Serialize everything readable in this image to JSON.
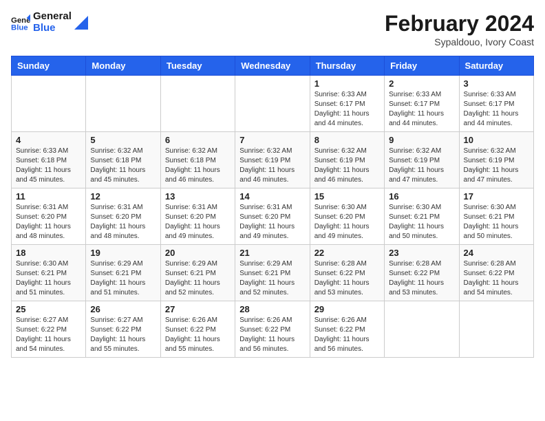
{
  "logo": {
    "text_general": "General",
    "text_blue": "Blue"
  },
  "title": "February 2024",
  "subtitle": "Sypaldouo, Ivory Coast",
  "days_of_week": [
    "Sunday",
    "Monday",
    "Tuesday",
    "Wednesday",
    "Thursday",
    "Friday",
    "Saturday"
  ],
  "weeks": [
    [
      {
        "day": "",
        "info": ""
      },
      {
        "day": "",
        "info": ""
      },
      {
        "day": "",
        "info": ""
      },
      {
        "day": "",
        "info": ""
      },
      {
        "day": "1",
        "info": "Sunrise: 6:33 AM\nSunset: 6:17 PM\nDaylight: 11 hours and 44 minutes."
      },
      {
        "day": "2",
        "info": "Sunrise: 6:33 AM\nSunset: 6:17 PM\nDaylight: 11 hours and 44 minutes."
      },
      {
        "day": "3",
        "info": "Sunrise: 6:33 AM\nSunset: 6:17 PM\nDaylight: 11 hours and 44 minutes."
      }
    ],
    [
      {
        "day": "4",
        "info": "Sunrise: 6:33 AM\nSunset: 6:18 PM\nDaylight: 11 hours and 45 minutes."
      },
      {
        "day": "5",
        "info": "Sunrise: 6:32 AM\nSunset: 6:18 PM\nDaylight: 11 hours and 45 minutes."
      },
      {
        "day": "6",
        "info": "Sunrise: 6:32 AM\nSunset: 6:18 PM\nDaylight: 11 hours and 46 minutes."
      },
      {
        "day": "7",
        "info": "Sunrise: 6:32 AM\nSunset: 6:19 PM\nDaylight: 11 hours and 46 minutes."
      },
      {
        "day": "8",
        "info": "Sunrise: 6:32 AM\nSunset: 6:19 PM\nDaylight: 11 hours and 46 minutes."
      },
      {
        "day": "9",
        "info": "Sunrise: 6:32 AM\nSunset: 6:19 PM\nDaylight: 11 hours and 47 minutes."
      },
      {
        "day": "10",
        "info": "Sunrise: 6:32 AM\nSunset: 6:19 PM\nDaylight: 11 hours and 47 minutes."
      }
    ],
    [
      {
        "day": "11",
        "info": "Sunrise: 6:31 AM\nSunset: 6:20 PM\nDaylight: 11 hours and 48 minutes."
      },
      {
        "day": "12",
        "info": "Sunrise: 6:31 AM\nSunset: 6:20 PM\nDaylight: 11 hours and 48 minutes."
      },
      {
        "day": "13",
        "info": "Sunrise: 6:31 AM\nSunset: 6:20 PM\nDaylight: 11 hours and 49 minutes."
      },
      {
        "day": "14",
        "info": "Sunrise: 6:31 AM\nSunset: 6:20 PM\nDaylight: 11 hours and 49 minutes."
      },
      {
        "day": "15",
        "info": "Sunrise: 6:30 AM\nSunset: 6:20 PM\nDaylight: 11 hours and 49 minutes."
      },
      {
        "day": "16",
        "info": "Sunrise: 6:30 AM\nSunset: 6:21 PM\nDaylight: 11 hours and 50 minutes."
      },
      {
        "day": "17",
        "info": "Sunrise: 6:30 AM\nSunset: 6:21 PM\nDaylight: 11 hours and 50 minutes."
      }
    ],
    [
      {
        "day": "18",
        "info": "Sunrise: 6:30 AM\nSunset: 6:21 PM\nDaylight: 11 hours and 51 minutes."
      },
      {
        "day": "19",
        "info": "Sunrise: 6:29 AM\nSunset: 6:21 PM\nDaylight: 11 hours and 51 minutes."
      },
      {
        "day": "20",
        "info": "Sunrise: 6:29 AM\nSunset: 6:21 PM\nDaylight: 11 hours and 52 minutes."
      },
      {
        "day": "21",
        "info": "Sunrise: 6:29 AM\nSunset: 6:21 PM\nDaylight: 11 hours and 52 minutes."
      },
      {
        "day": "22",
        "info": "Sunrise: 6:28 AM\nSunset: 6:22 PM\nDaylight: 11 hours and 53 minutes."
      },
      {
        "day": "23",
        "info": "Sunrise: 6:28 AM\nSunset: 6:22 PM\nDaylight: 11 hours and 53 minutes."
      },
      {
        "day": "24",
        "info": "Sunrise: 6:28 AM\nSunset: 6:22 PM\nDaylight: 11 hours and 54 minutes."
      }
    ],
    [
      {
        "day": "25",
        "info": "Sunrise: 6:27 AM\nSunset: 6:22 PM\nDaylight: 11 hours and 54 minutes."
      },
      {
        "day": "26",
        "info": "Sunrise: 6:27 AM\nSunset: 6:22 PM\nDaylight: 11 hours and 55 minutes."
      },
      {
        "day": "27",
        "info": "Sunrise: 6:26 AM\nSunset: 6:22 PM\nDaylight: 11 hours and 55 minutes."
      },
      {
        "day": "28",
        "info": "Sunrise: 6:26 AM\nSunset: 6:22 PM\nDaylight: 11 hours and 56 minutes."
      },
      {
        "day": "29",
        "info": "Sunrise: 6:26 AM\nSunset: 6:22 PM\nDaylight: 11 hours and 56 minutes."
      },
      {
        "day": "",
        "info": ""
      },
      {
        "day": "",
        "info": ""
      }
    ]
  ]
}
